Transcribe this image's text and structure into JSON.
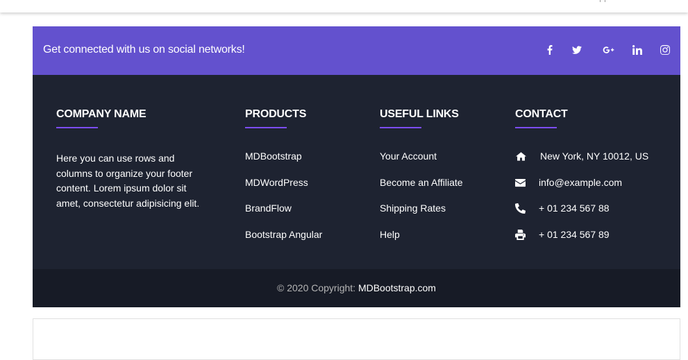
{
  "social": {
    "text": "Get connected with us on social networks!",
    "icons": [
      "facebook-icon",
      "twitter-icon",
      "google-plus-icon",
      "linkedin-icon",
      "instagram-icon"
    ],
    "band_color": "#6351ce"
  },
  "company": {
    "title": "COMPANY NAME",
    "text": "Here you can use rows and columns to organize your footer content. Lorem ipsum dolor sit amet, consectetur adipisicing elit."
  },
  "products": {
    "title": "PRODUCTS",
    "items": [
      "MDBootstrap",
      "MDWordPress",
      "BrandFlow",
      "Bootstrap Angular"
    ]
  },
  "useful_links": {
    "title": "USEFUL LINKS",
    "items": [
      "Your Account",
      "Become an Affiliate",
      "Shipping Rates",
      "Help"
    ]
  },
  "contact": {
    "title": "CONTACT",
    "items": [
      {
        "icon": "home-icon",
        "text": "New York, NY 10012, US"
      },
      {
        "icon": "envelope-icon",
        "text": "info@example.com"
      },
      {
        "icon": "phone-icon",
        "text": "+ 01 234 567 88"
      },
      {
        "icon": "print-icon",
        "text": "+ 01 234 567 89"
      }
    ]
  },
  "copyright": {
    "prefix": "© 2020 Copyright: ",
    "link": "MDBootstrap.com"
  },
  "colors": {
    "footer_bg": "#1e2331",
    "copyright_bg": "#171b26",
    "accent_rule": "#7c4dff"
  }
}
